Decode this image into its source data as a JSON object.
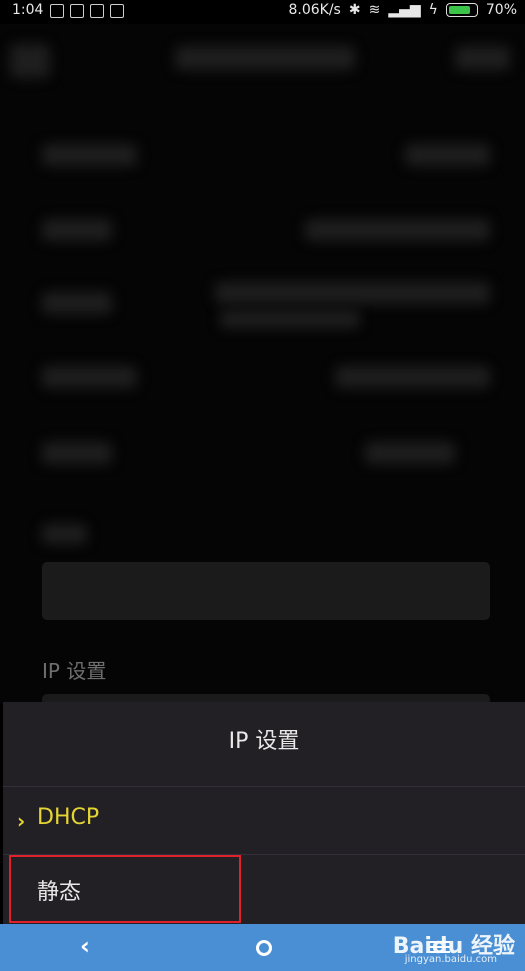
{
  "status_bar": {
    "time": "1:04",
    "net_speed": "8.06K/s",
    "battery_percent": "70%",
    "icons": [
      "notification-icon",
      "bluetooth-icon",
      "wifi-icon",
      "signal-icon",
      "charging-icon",
      "battery-icon"
    ]
  },
  "background": {
    "ip_settings_label": "IP 设置"
  },
  "dialog": {
    "title": "IP 设置",
    "options": [
      {
        "label": "DHCP",
        "selected": true
      },
      {
        "label": "静态",
        "selected": false
      }
    ]
  },
  "watermark": {
    "brand": "Baidu 经验",
    "url": "jingyan.baidu.com"
  },
  "colors": {
    "accent": "#e4d533",
    "dialog_bg": "#221f25",
    "nav_bg": "#4a8fd3",
    "highlight": "#e0202a"
  }
}
